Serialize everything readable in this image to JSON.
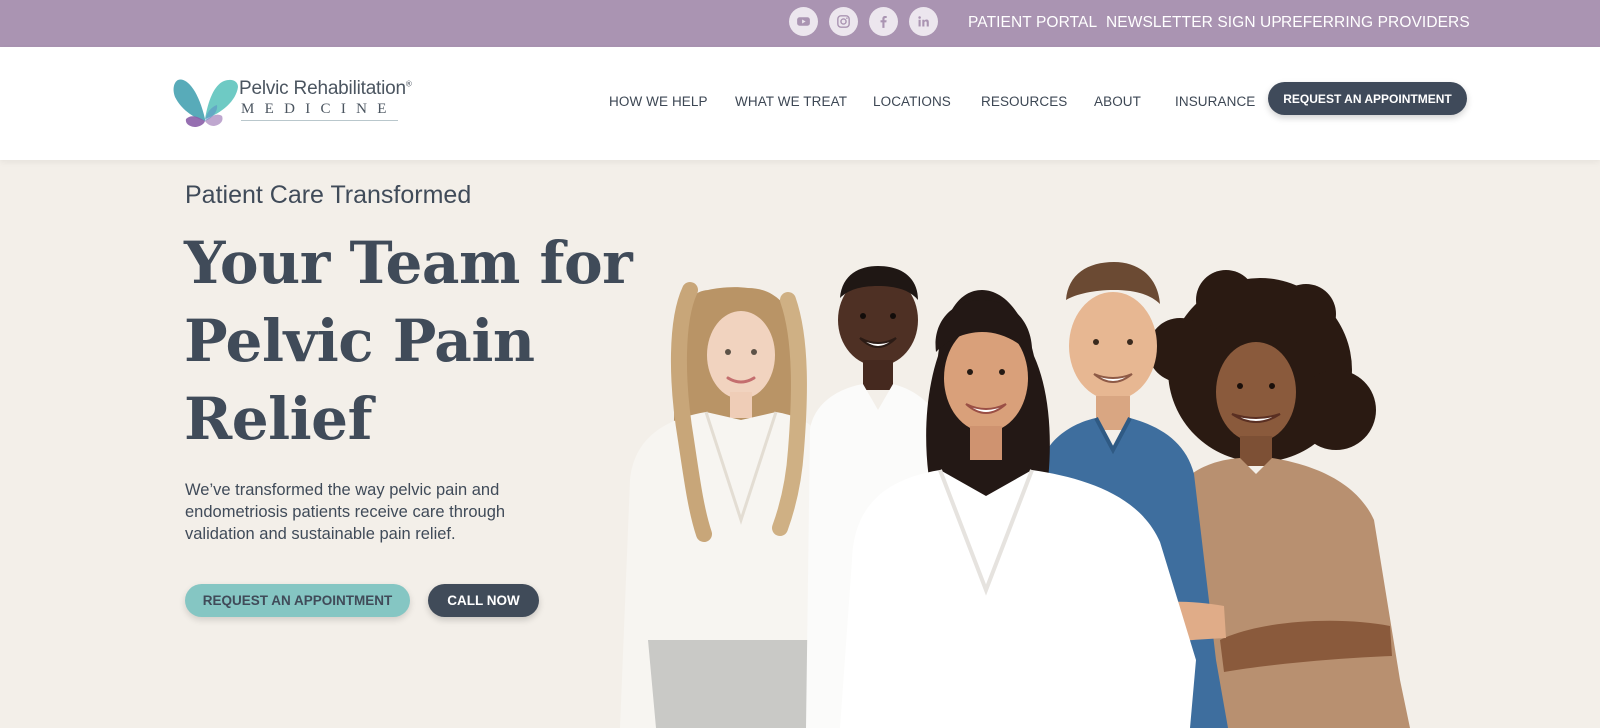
{
  "topbar": {
    "social": [
      {
        "icon": "youtube-icon"
      },
      {
        "icon": "instagram-icon"
      },
      {
        "icon": "facebook-icon"
      },
      {
        "icon": "linkedin-icon"
      }
    ],
    "links": [
      "PATIENT PORTAL",
      "NEWSLETTER SIGN UP",
      "REFERRING PROVIDERS"
    ]
  },
  "logo": {
    "line1": "Pelvic Rehabilitation",
    "trademark": "®",
    "line2": "MEDICINE"
  },
  "nav": {
    "items": [
      "HOW WE HELP",
      "WHAT WE TREAT",
      "LOCATIONS",
      "RESOURCES",
      "ABOUT",
      "INSURANCE"
    ],
    "cta": "REQUEST AN APPOINTMENT"
  },
  "hero": {
    "eyebrow": "Patient Care Transformed",
    "title_lines": [
      "Your Team for",
      "Pelvic Pain",
      "Relief"
    ],
    "description": "We’ve transformed the way pelvic pain and endometriosis patients receive care through validation and sustainable pain relief.",
    "primary_button": "REQUEST AN APPOINTMENT",
    "secondary_button": "CALL NOW"
  },
  "colors": {
    "topbar": "#aa94b2",
    "background": "#f3efe9",
    "primary_dark": "#404b59",
    "accent_teal": "#85c6c3",
    "logo_purple": "#8b5fa8"
  }
}
